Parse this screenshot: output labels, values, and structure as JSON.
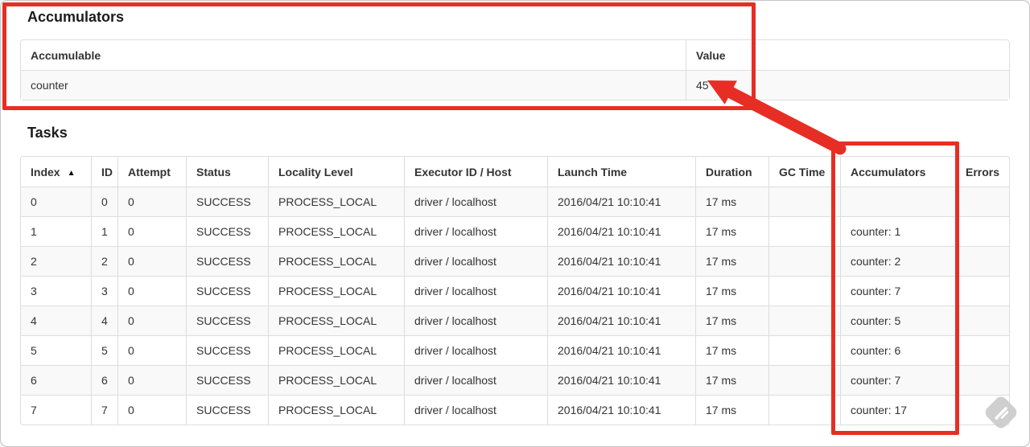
{
  "accumulators_section": {
    "title": "Accumulators",
    "table": {
      "headers": [
        "Accumulable",
        "Value"
      ],
      "rows": [
        {
          "accumulable": "counter",
          "value": "45"
        }
      ]
    }
  },
  "tasks_section": {
    "title": "Tasks",
    "table": {
      "sort_indicator": "▲",
      "headers": [
        "Index",
        "ID",
        "Attempt",
        "Status",
        "Locality Level",
        "Executor ID / Host",
        "Launch Time",
        "Duration",
        "GC Time",
        "Accumulators",
        "Errors"
      ],
      "columns": [
        "index",
        "id",
        "attempt",
        "status",
        "locality_level",
        "executor_id_host",
        "launch_time",
        "duration",
        "gc_time",
        "accumulators",
        "errors"
      ],
      "rows": [
        {
          "index": "0",
          "id": "0",
          "attempt": "0",
          "status": "SUCCESS",
          "locality_level": "PROCESS_LOCAL",
          "executor_id_host": "driver / localhost",
          "launch_time": "2016/04/21 10:10:41",
          "duration": "17 ms",
          "gc_time": "",
          "accumulators": "",
          "errors": ""
        },
        {
          "index": "1",
          "id": "1",
          "attempt": "0",
          "status": "SUCCESS",
          "locality_level": "PROCESS_LOCAL",
          "executor_id_host": "driver / localhost",
          "launch_time": "2016/04/21 10:10:41",
          "duration": "17 ms",
          "gc_time": "",
          "accumulators": "counter: 1",
          "errors": ""
        },
        {
          "index": "2",
          "id": "2",
          "attempt": "0",
          "status": "SUCCESS",
          "locality_level": "PROCESS_LOCAL",
          "executor_id_host": "driver / localhost",
          "launch_time": "2016/04/21 10:10:41",
          "duration": "17 ms",
          "gc_time": "",
          "accumulators": "counter: 2",
          "errors": ""
        },
        {
          "index": "3",
          "id": "3",
          "attempt": "0",
          "status": "SUCCESS",
          "locality_level": "PROCESS_LOCAL",
          "executor_id_host": "driver / localhost",
          "launch_time": "2016/04/21 10:10:41",
          "duration": "17 ms",
          "gc_time": "",
          "accumulators": "counter: 7",
          "errors": ""
        },
        {
          "index": "4",
          "id": "4",
          "attempt": "0",
          "status": "SUCCESS",
          "locality_level": "PROCESS_LOCAL",
          "executor_id_host": "driver / localhost",
          "launch_time": "2016/04/21 10:10:41",
          "duration": "17 ms",
          "gc_time": "",
          "accumulators": "counter: 5",
          "errors": ""
        },
        {
          "index": "5",
          "id": "5",
          "attempt": "0",
          "status": "SUCCESS",
          "locality_level": "PROCESS_LOCAL",
          "executor_id_host": "driver / localhost",
          "launch_time": "2016/04/21 10:10:41",
          "duration": "17 ms",
          "gc_time": "",
          "accumulators": "counter: 6",
          "errors": ""
        },
        {
          "index": "6",
          "id": "6",
          "attempt": "0",
          "status": "SUCCESS",
          "locality_level": "PROCESS_LOCAL",
          "executor_id_host": "driver / localhost",
          "launch_time": "2016/04/21 10:10:41",
          "duration": "17 ms",
          "gc_time": "",
          "accumulators": "counter: 7",
          "errors": ""
        },
        {
          "index": "7",
          "id": "7",
          "attempt": "0",
          "status": "SUCCESS",
          "locality_level": "PROCESS_LOCAL",
          "executor_id_host": "driver / localhost",
          "launch_time": "2016/04/21 10:10:41",
          "duration": "17 ms",
          "gc_time": "",
          "accumulators": "counter: 17",
          "errors": ""
        }
      ]
    }
  },
  "annotations": {
    "highlight_color": "#e62e24",
    "watermark_color": "#cbcbcb"
  }
}
